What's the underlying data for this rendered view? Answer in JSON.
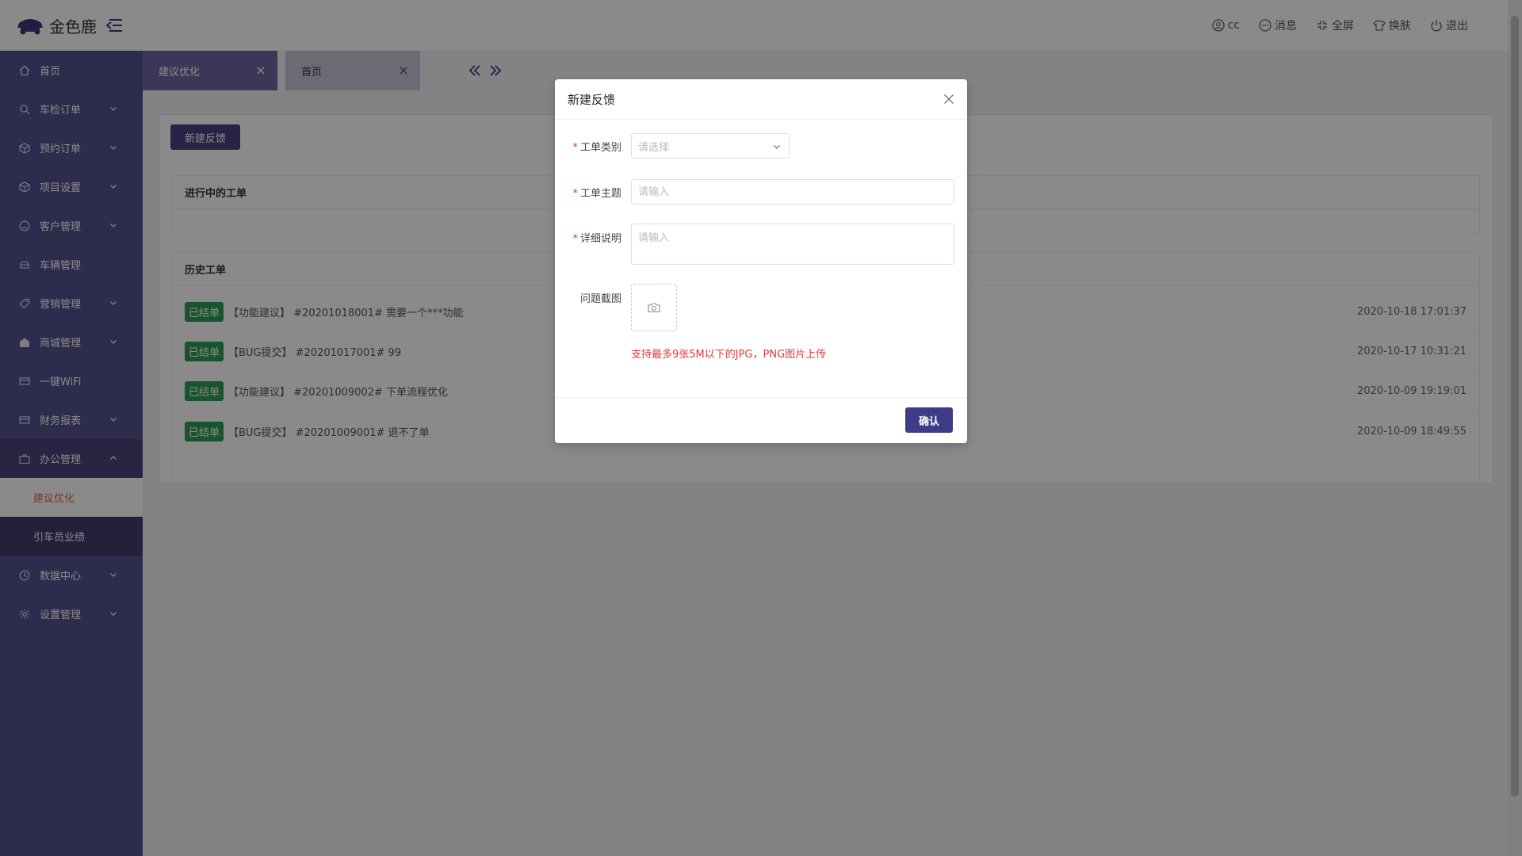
{
  "header": {
    "logo_text": "金色鹿",
    "user": "cc",
    "messages": "消息",
    "fullscreen": "全屏",
    "skin": "换肤",
    "logout": "退出"
  },
  "sidebar": {
    "items": [
      {
        "label": "首页",
        "icon": "home-icon",
        "expandable": false
      },
      {
        "label": "车检订单",
        "icon": "search-icon",
        "expandable": true
      },
      {
        "label": "预约订单",
        "icon": "box-icon",
        "expandable": true
      },
      {
        "label": "项目设置",
        "icon": "box-icon",
        "expandable": true
      },
      {
        "label": "客户管理",
        "icon": "smile-icon",
        "expandable": true
      },
      {
        "label": "车辆管理",
        "icon": "car-icon",
        "expandable": false
      },
      {
        "label": "营销管理",
        "icon": "tag-icon",
        "expandable": true
      },
      {
        "label": "商城管理",
        "icon": "shop-icon",
        "expandable": true
      },
      {
        "label": "一键WiFi",
        "icon": "card-icon",
        "expandable": false
      },
      {
        "label": "财务报表",
        "icon": "card-icon",
        "expandable": true
      },
      {
        "label": "办公管理",
        "icon": "briefcase-icon",
        "expandable": true,
        "open": true
      },
      {
        "label": "数据中心",
        "icon": "clock-icon",
        "expandable": true
      },
      {
        "label": "设置管理",
        "icon": "gear-icon",
        "expandable": true
      }
    ],
    "office_sub": [
      {
        "label": "建议优化",
        "active": true
      },
      {
        "label": "引车员业绩",
        "active": false
      }
    ]
  },
  "tabs": [
    {
      "label": "建议优化",
      "active": true
    },
    {
      "label": "首页",
      "active": false
    }
  ],
  "content": {
    "new_button": "新建反馈",
    "in_progress_title": "进行中的工单",
    "history_title": "历史工单",
    "history": [
      {
        "badge": "已结单",
        "text": "【功能建议】 #20201018001# 需要一个***功能",
        "time": "2020-10-18 17:01:37"
      },
      {
        "badge": "已结单",
        "text": "【BUG提交】 #20201017001# 99",
        "time": "2020-10-17 10:31:21"
      },
      {
        "badge": "已结单",
        "text": "【功能建议】 #20201009002# 下单流程优化",
        "time": "2020-10-09 19:19:01"
      },
      {
        "badge": "已结单",
        "text": "【BUG提交】 #20201009001# 退不了单",
        "time": "2020-10-09 18:49:55"
      }
    ]
  },
  "dialog": {
    "title": "新建反馈",
    "category_label": "工单类别",
    "category_placeholder": "请选择",
    "subject_label": "工单主题",
    "subject_placeholder": "请输入",
    "detail_label": "详细说明",
    "detail_placeholder": "请输入",
    "screenshot_label": "问题截图",
    "hint": "支持最多9张5M以下的JPG，PNG图片上传",
    "required_mark": "*",
    "confirm": "确认"
  }
}
